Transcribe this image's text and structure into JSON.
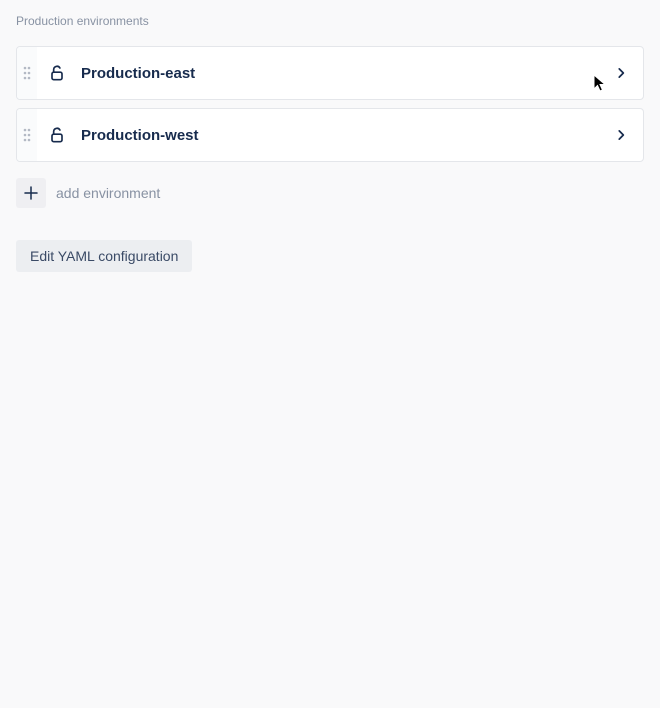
{
  "section_title": "Production environments",
  "environments": [
    {
      "name": "Production-east"
    },
    {
      "name": "Production-west"
    }
  ],
  "add_environment_label": "add environment",
  "yaml_button_label": "Edit YAML configuration"
}
